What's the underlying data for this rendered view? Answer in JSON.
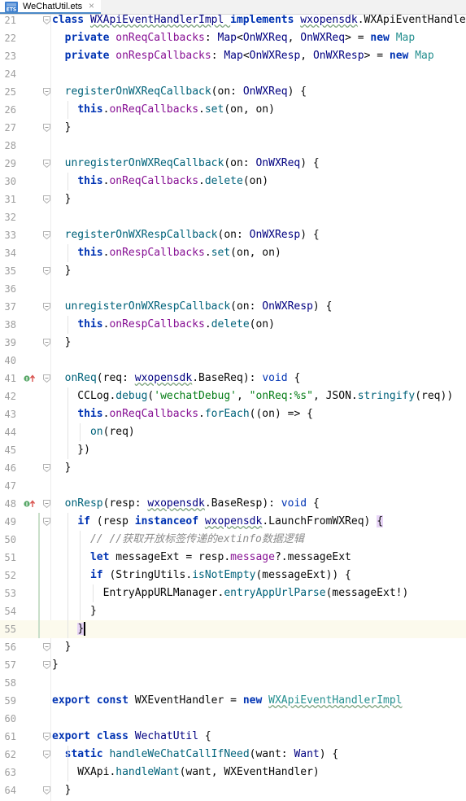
{
  "tab": {
    "title": "WeChatUtil.ets",
    "icon": "ets-file-icon",
    "close": "×"
  },
  "caret_line": 55,
  "lines": [
    {
      "n": "21",
      "t": [
        [
          "class ",
          "k"
        ],
        [
          "WXApiEventHandlerImpl ",
          "ty"
        ],
        [
          "implements ",
          "k"
        ],
        [
          "wxopensdk",
          "ty"
        ],
        [
          ".WXApiEventHandler",
          ""
        ]
      ]
    },
    {
      "n": "22",
      "t": [
        [
          "  private ",
          "k"
        ],
        [
          "onReqCallbacks",
          "pr"
        ],
        [
          ": ",
          ""
        ],
        [
          "Map",
          "ty"
        ],
        [
          "<",
          ""
        ],
        [
          "OnWXReq",
          "ty"
        ],
        [
          ", ",
          ""
        ],
        [
          "OnWXReq",
          "ty"
        ],
        [
          "> = ",
          ""
        ],
        [
          "new ",
          "k"
        ],
        [
          "Map",
          "tc"
        ]
      ]
    },
    {
      "n": "23",
      "t": [
        [
          "  private ",
          "k"
        ],
        [
          "onRespCallbacks",
          "pr"
        ],
        [
          ": ",
          ""
        ],
        [
          "Map",
          "ty"
        ],
        [
          "<",
          ""
        ],
        [
          "OnWXResp",
          "ty"
        ],
        [
          ", ",
          ""
        ],
        [
          "OnWXResp",
          "ty"
        ],
        [
          "> = ",
          ""
        ],
        [
          "new ",
          "k"
        ],
        [
          "Map",
          "tc"
        ]
      ]
    },
    {
      "n": "24",
      "t": []
    },
    {
      "n": "25",
      "t": [
        [
          "  ",
          ""
        ],
        [
          "registerOnWXReqCallback",
          "fn"
        ],
        [
          "(on: ",
          ""
        ],
        [
          "OnWXReq",
          "ty"
        ],
        [
          ") {",
          ""
        ]
      ]
    },
    {
      "n": "26",
      "t": [
        [
          "    ",
          ""
        ],
        [
          "this",
          "k"
        ],
        [
          ".",
          ""
        ],
        [
          "onReqCallbacks",
          "pr"
        ],
        [
          ".",
          ""
        ],
        [
          "set",
          "fn"
        ],
        [
          "(on, on)",
          ""
        ]
      ]
    },
    {
      "n": "27",
      "t": [
        [
          "  }",
          ""
        ]
      ]
    },
    {
      "n": "28",
      "t": []
    },
    {
      "n": "29",
      "t": [
        [
          "  ",
          ""
        ],
        [
          "unregisterOnWXReqCallback",
          "fn"
        ],
        [
          "(on: ",
          ""
        ],
        [
          "OnWXReq",
          "ty"
        ],
        [
          ") {",
          ""
        ]
      ]
    },
    {
      "n": "30",
      "t": [
        [
          "    ",
          ""
        ],
        [
          "this",
          "k"
        ],
        [
          ".",
          ""
        ],
        [
          "onReqCallbacks",
          "pr"
        ],
        [
          ".",
          ""
        ],
        [
          "delete",
          "fn"
        ],
        [
          "(on)",
          ""
        ]
      ]
    },
    {
      "n": "31",
      "t": [
        [
          "  }",
          ""
        ]
      ]
    },
    {
      "n": "32",
      "t": []
    },
    {
      "n": "33",
      "t": [
        [
          "  ",
          ""
        ],
        [
          "registerOnWXRespCallback",
          "fn"
        ],
        [
          "(on: ",
          ""
        ],
        [
          "OnWXResp",
          "ty"
        ],
        [
          ") {",
          ""
        ]
      ]
    },
    {
      "n": "34",
      "t": [
        [
          "    ",
          ""
        ],
        [
          "this",
          "k"
        ],
        [
          ".",
          ""
        ],
        [
          "onRespCallbacks",
          "pr"
        ],
        [
          ".",
          ""
        ],
        [
          "set",
          "fn"
        ],
        [
          "(on, on)",
          ""
        ]
      ]
    },
    {
      "n": "35",
      "t": [
        [
          "  }",
          ""
        ]
      ]
    },
    {
      "n": "36",
      "t": []
    },
    {
      "n": "37",
      "t": [
        [
          "  ",
          ""
        ],
        [
          "unregisterOnWXRespCallback",
          "fn"
        ],
        [
          "(on: ",
          ""
        ],
        [
          "OnWXResp",
          "ty"
        ],
        [
          ") {",
          ""
        ]
      ]
    },
    {
      "n": "38",
      "t": [
        [
          "    ",
          ""
        ],
        [
          "this",
          "k"
        ],
        [
          ".",
          ""
        ],
        [
          "onRespCallbacks",
          "pr"
        ],
        [
          ".",
          ""
        ],
        [
          "delete",
          "fn"
        ],
        [
          "(on)",
          ""
        ]
      ]
    },
    {
      "n": "39",
      "t": [
        [
          "  }",
          ""
        ]
      ]
    },
    {
      "n": "40",
      "t": []
    },
    {
      "n": "41",
      "t": [
        [
          "  ",
          ""
        ],
        [
          "onReq",
          "fn"
        ],
        [
          "(req: ",
          ""
        ],
        [
          "wxopensdk",
          "ty"
        ],
        [
          ".BaseReq): ",
          ""
        ],
        [
          "void ",
          "k2"
        ],
        [
          "{",
          ""
        ]
      ]
    },
    {
      "n": "42",
      "t": [
        [
          "    CCLog.",
          ""
        ],
        [
          "debug",
          "fn"
        ],
        [
          "(",
          ""
        ],
        [
          "'wechatDebug'",
          "st"
        ],
        [
          ", ",
          ""
        ],
        [
          "\"onReq:%s\"",
          "st"
        ],
        [
          ", JSON.",
          ""
        ],
        [
          "stringify",
          "fn"
        ],
        [
          "(req))",
          ""
        ]
      ]
    },
    {
      "n": "43",
      "t": [
        [
          "    ",
          ""
        ],
        [
          "this",
          "k"
        ],
        [
          ".",
          ""
        ],
        [
          "onReqCallbacks",
          "pr"
        ],
        [
          ".",
          ""
        ],
        [
          "forEach",
          "fn"
        ],
        [
          "((on) => {",
          ""
        ]
      ]
    },
    {
      "n": "44",
      "t": [
        [
          "      ",
          ""
        ],
        [
          "on",
          "fn"
        ],
        [
          "(req)",
          ""
        ]
      ]
    },
    {
      "n": "45",
      "t": [
        [
          "    })",
          ""
        ]
      ]
    },
    {
      "n": "46",
      "t": [
        [
          "  }",
          ""
        ]
      ]
    },
    {
      "n": "47",
      "t": []
    },
    {
      "n": "48",
      "t": [
        [
          "  ",
          ""
        ],
        [
          "onResp",
          "fn"
        ],
        [
          "(resp: ",
          ""
        ],
        [
          "wxopensdk",
          "ty"
        ],
        [
          ".BaseResp): ",
          ""
        ],
        [
          "void ",
          "k2"
        ],
        [
          "{",
          ""
        ]
      ]
    },
    {
      "n": "49",
      "t": [
        [
          "    ",
          ""
        ],
        [
          "if ",
          "k"
        ],
        [
          "(resp ",
          ""
        ],
        [
          "instanceof ",
          "k"
        ],
        [
          "wxopensdk",
          "ty"
        ],
        [
          ".LaunchFromWXReq) ",
          ""
        ],
        [
          "{",
          "hl"
        ]
      ]
    },
    {
      "n": "50",
      "t": [
        [
          "      ",
          ""
        ],
        [
          "// //获取开放标签传递的extinfo数据逻辑",
          "cm"
        ]
      ]
    },
    {
      "n": "51",
      "t": [
        [
          "      ",
          ""
        ],
        [
          "let ",
          "k"
        ],
        [
          "messageExt = resp.",
          ""
        ],
        [
          "message",
          "pr"
        ],
        [
          "?.messageExt",
          ""
        ]
      ]
    },
    {
      "n": "52",
      "t": [
        [
          "      ",
          ""
        ],
        [
          "if ",
          "k"
        ],
        [
          "(StringUtils.",
          ""
        ],
        [
          "isNotEmpty",
          "fn"
        ],
        [
          "(messageExt)) {",
          ""
        ]
      ]
    },
    {
      "n": "53",
      "t": [
        [
          "        EntryAppURLManager.",
          ""
        ],
        [
          "entryAppUrlParse",
          "fn"
        ],
        [
          "(messageExt!)",
          ""
        ]
      ]
    },
    {
      "n": "54",
      "t": [
        [
          "      }",
          ""
        ]
      ]
    },
    {
      "n": "55",
      "t": [
        [
          "    ",
          ""
        ],
        [
          "}",
          "hl"
        ]
      ]
    },
    {
      "n": "56",
      "t": [
        [
          "  }",
          ""
        ]
      ]
    },
    {
      "n": "57",
      "t": [
        [
          "}",
          ""
        ]
      ]
    },
    {
      "n": "58",
      "t": []
    },
    {
      "n": "59",
      "t": [
        [
          "export ",
          "k"
        ],
        [
          "const ",
          "k"
        ],
        [
          "WXEventHandler = ",
          ""
        ],
        [
          "new ",
          "k"
        ],
        [
          "WXApiEventHandlerImpl",
          "tc"
        ]
      ]
    },
    {
      "n": "60",
      "t": []
    },
    {
      "n": "61",
      "t": [
        [
          "export ",
          "k"
        ],
        [
          "class ",
          "k"
        ],
        [
          "WechatUtil ",
          "ty"
        ],
        [
          "{",
          ""
        ]
      ]
    },
    {
      "n": "62",
      "t": [
        [
          "  ",
          ""
        ],
        [
          "static ",
          "k"
        ],
        [
          "handleWeChatCallIfNeed",
          "fn"
        ],
        [
          "(want: ",
          ""
        ],
        [
          "Want",
          "ty"
        ],
        [
          ") {",
          ""
        ]
      ]
    },
    {
      "n": "63",
      "t": [
        [
          "    WXApi.",
          ""
        ],
        [
          "handleWant",
          "fn"
        ],
        [
          "(want, WXEventHandler)",
          ""
        ]
      ]
    },
    {
      "n": "64",
      "t": [
        [
          "  }",
          ""
        ]
      ]
    }
  ]
}
